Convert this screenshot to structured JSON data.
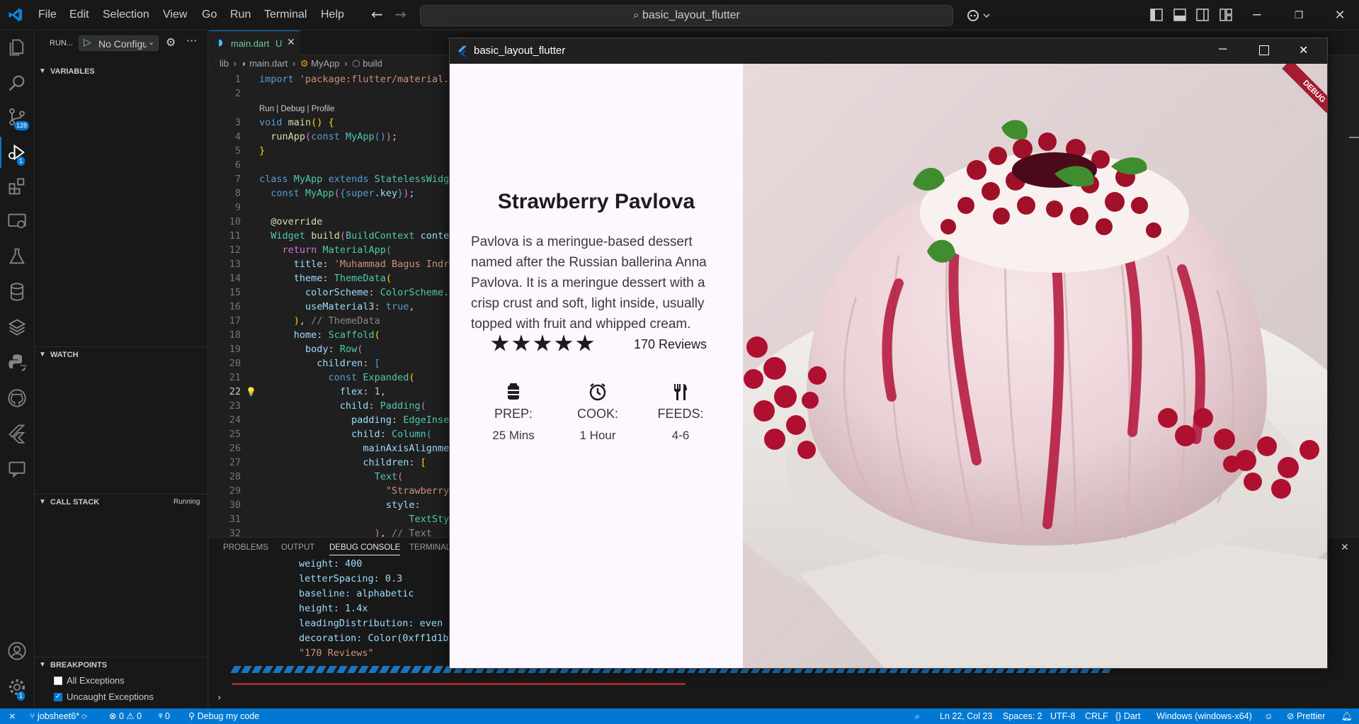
{
  "titlebar": {
    "menu": [
      "File",
      "Edit",
      "Selection",
      "View",
      "Go",
      "Run",
      "Terminal",
      "Help"
    ],
    "command_center": "basic_layout_flutter"
  },
  "activity": {
    "source_control_badge": "128",
    "run_debug_badge": "1",
    "settings_badge": "1"
  },
  "sidebar": {
    "run_label": "RUN...",
    "config": "No Configu",
    "variables": "VARIABLES",
    "watch": "WATCH",
    "call_stack": "CALL STACK",
    "call_stack_status": "Running",
    "breakpoints": "BREAKPOINTS",
    "bp_all": "All Exceptions",
    "bp_uncaught": "Uncaught Exceptions"
  },
  "editor": {
    "tab_name": "main.dart",
    "tab_status": "U",
    "breadcrumb": [
      "lib",
      "main.dart",
      "MyApp",
      "build"
    ],
    "codelens": "Run | Debug | Profile",
    "current_line": "22"
  },
  "panel": {
    "tabs": [
      "PROBLEMS",
      "OUTPUT",
      "DEBUG CONSOLE",
      "TERMINAL"
    ],
    "active_tab": "DEBUG CONSOLE",
    "console_lines": [
      "weight: 400",
      "letterSpacing: 0.3",
      "baseline: alphabetic",
      "height: 1.4x",
      "leadingDistribution: even",
      "decoration: Color(0xff1d1b2",
      "\"170 Reviews\""
    ]
  },
  "status": {
    "branch": "jobsheet6*",
    "errors": "0",
    "warnings": "0",
    "ports": "0",
    "debug": "Debug my code",
    "position": "Ln 22, Col 23",
    "spaces": "Spaces: 2",
    "encoding": "UTF-8",
    "eol": "CRLF",
    "language": "Dart",
    "device": "Windows (windows-x64)",
    "formatter": "Prettier"
  },
  "flutter_app": {
    "window_title": "basic_layout_flutter",
    "debug_banner": "DEBUG",
    "title": "Strawberry Pavlova",
    "description": "Pavlova is a meringue-based dessert named after the Russian ballerina Anna Pavlova. It is a meringue dessert with a crisp crust and soft, light inside, usually topped with fruit and whipped cream.",
    "rating": 5,
    "reviews": "170 Reviews",
    "stats": [
      {
        "icon": "kitchen-icon",
        "label": "PREP:",
        "value": "25 Mins"
      },
      {
        "icon": "timer-icon",
        "label": "COOK:",
        "value": "1 Hour"
      },
      {
        "icon": "restaurant-icon",
        "label": "FEEDS:",
        "value": "4-6"
      }
    ]
  },
  "colors": {
    "accent": "#0078d4",
    "app_bg": "#fdf7ff",
    "editor_bg": "#1f1f1f"
  }
}
